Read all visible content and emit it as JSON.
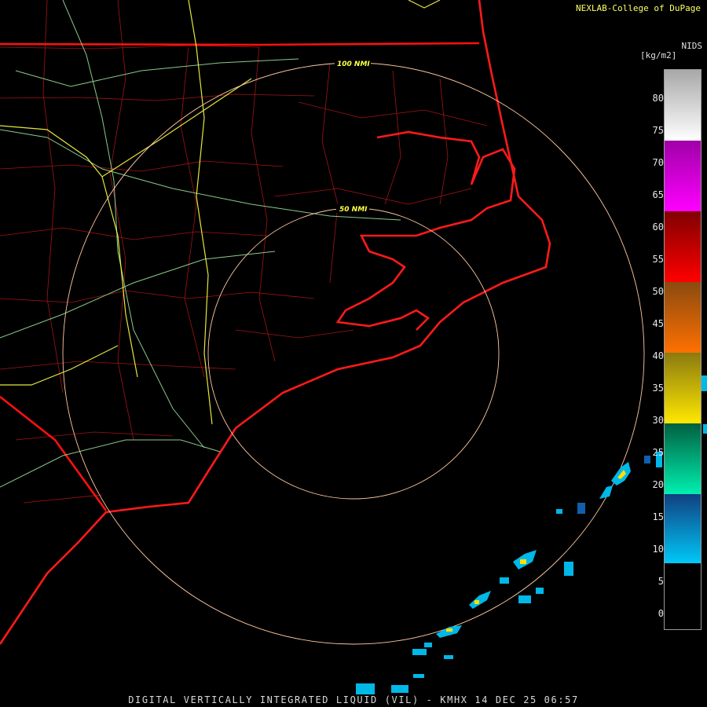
{
  "credit": "NEXLAB-College of DuPage",
  "product_label": "NIDS",
  "units": "[kg/m2]",
  "footer": "DIGITAL VERTICALLY INTEGRATED LIQUID (VIL) - KMHX 14 DEC 25 06:57",
  "range_rings": [
    {
      "label": "50 NMI"
    },
    {
      "label": "100 NMI"
    }
  ],
  "colorbar": {
    "ticks": [
      "80",
      "75",
      "70",
      "65",
      "60",
      "55",
      "50",
      "45",
      "40",
      "35",
      "30",
      "25",
      "20",
      "15",
      "10",
      "5",
      "0"
    ],
    "colors": {
      "snow": "#ffffff",
      "magenta": "#a000a8",
      "red_dark": "#a00000",
      "orange": "#d07000",
      "yellow": "#ffe000",
      "green": "#008060",
      "blue": "#1060b0",
      "cyan": "#00b8e8",
      "map_borders": "#ff0000",
      "map_counties": "#cc2020",
      "roads_green": "#a0e0a0",
      "roads_yellow": "#ffff44",
      "range_rings": "#ffc8a0"
    }
  }
}
